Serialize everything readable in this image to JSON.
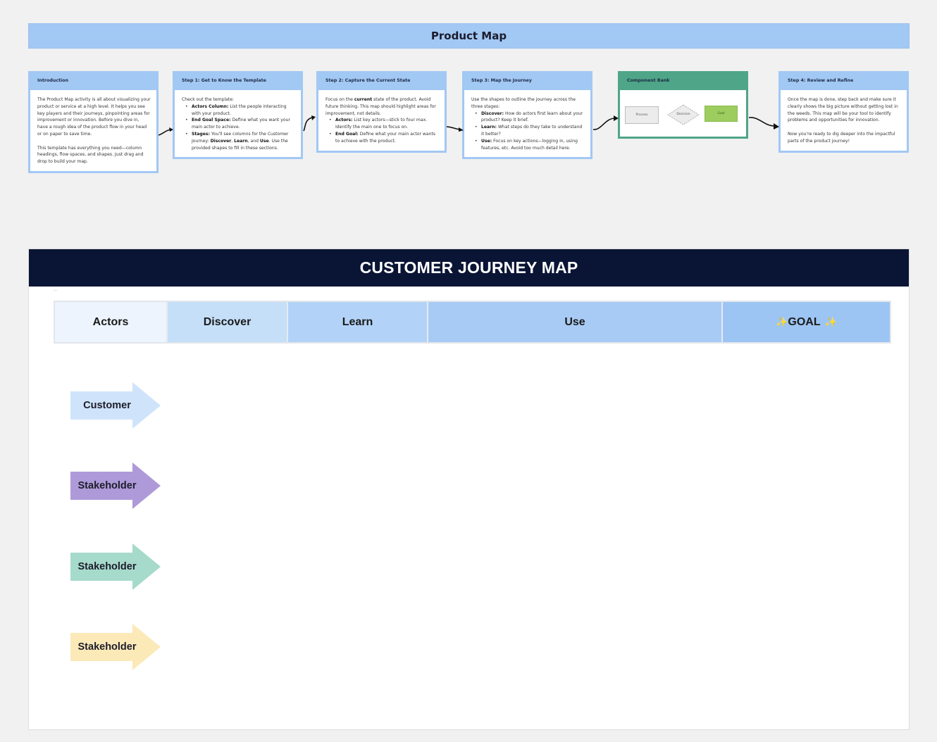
{
  "product_map": {
    "title": "Product Map",
    "cards": [
      {
        "title": "Introduction",
        "paragraphs": [
          "The Product Map activity is all about visualizing your product or service at a high level. It helps you see key players and their journeys, pinpointing areas for improvement or innovation. Before you dive in, have a rough idea of the product flow in your head or on paper to save time.",
          "This template has everything you need—column headings, flow spaces, and shapes. Just drag and drop to build your map."
        ]
      },
      {
        "title": "Step 1: Get to Know the Template",
        "intro": "Check out the template:",
        "bullets": [
          {
            "bold": "Actors Column:",
            "text": " List the people interacting with your product."
          },
          {
            "bold": "End Goal Space:",
            "text": " Define what you want your main actor to achieve."
          },
          {
            "bold": "Stages:",
            "text": " You'll see columns for the Customer Journey: ",
            "bold2": "Discover",
            "text2": ", ",
            "bold3": "Learn",
            "text3": ", and ",
            "bold4": "Use",
            "text4": ". Use the provided shapes to fill in these sections."
          }
        ]
      },
      {
        "title": "Step 2: Capture the Current State",
        "intro_pre": "Focus on the ",
        "intro_bold": "current",
        "intro_post": " state of the product. Avoid future thinking. This map should highlight areas for improvement, not details.",
        "bullets": [
          {
            "bold": "Actors:",
            "text": " List key actors—stick to four max. Identify the main one to focus on."
          },
          {
            "bold": "End Goal:",
            "text": " Define what your main actor wants to achieve with the product."
          }
        ]
      },
      {
        "title": "Step 3: Map the Journey",
        "intro": "Use the shapes to outline the journey across the three stages:",
        "bullets": [
          {
            "bold": "Discover:",
            "text": " How do actors first learn about your product? Keep it brief."
          },
          {
            "bold": "Learn:",
            "text": " What steps do they take to understand it better?"
          },
          {
            "bold": "Use:",
            "text": " Focus on key actions—logging in, using features, etc. Avoid too much detail here."
          }
        ]
      },
      {
        "title": "Component Bank",
        "shapes": {
          "process": "Process",
          "decision": "Decision",
          "goal": "Goal"
        }
      },
      {
        "title": "Step 4: Review and Refine",
        "paragraphs": [
          "Once the map is done, step back and make sure it clearly shows the big picture without getting lost in the weeds. This map will be your tool to identify problems and opportunities for innovation.",
          "Now you're ready to dig deeper into the impactful parts of the product journey!"
        ]
      }
    ]
  },
  "journey_map": {
    "title": "CUSTOMER JOURNEY MAP",
    "marker": "...",
    "stages": [
      {
        "label": "Actors",
        "color": "#edf4fd"
      },
      {
        "label": "Discover",
        "color": "#c5dff8"
      },
      {
        "label": "Learn",
        "color": "#b2d3f7"
      },
      {
        "label": "Use",
        "color": "#a8cbf5"
      },
      {
        "label": "GOAL",
        "color": "#9dc5f3",
        "decoration": "✨"
      }
    ],
    "actors": [
      {
        "label": "Customer",
        "color": "#cfe4fb"
      },
      {
        "label": "Stakeholder",
        "color": "#ae9ad9"
      },
      {
        "label": "Stakeholder",
        "color": "#a6dacb"
      },
      {
        "label": "Stakeholder",
        "color": "#fbe9b8"
      }
    ]
  },
  "colors": {
    "title_bar": "#a2c8f4",
    "card_header": "#a2c8f4",
    "component_bank_header": "#4fa587",
    "journey_header": "#0a1535",
    "canvas": "#f1f1f1"
  }
}
